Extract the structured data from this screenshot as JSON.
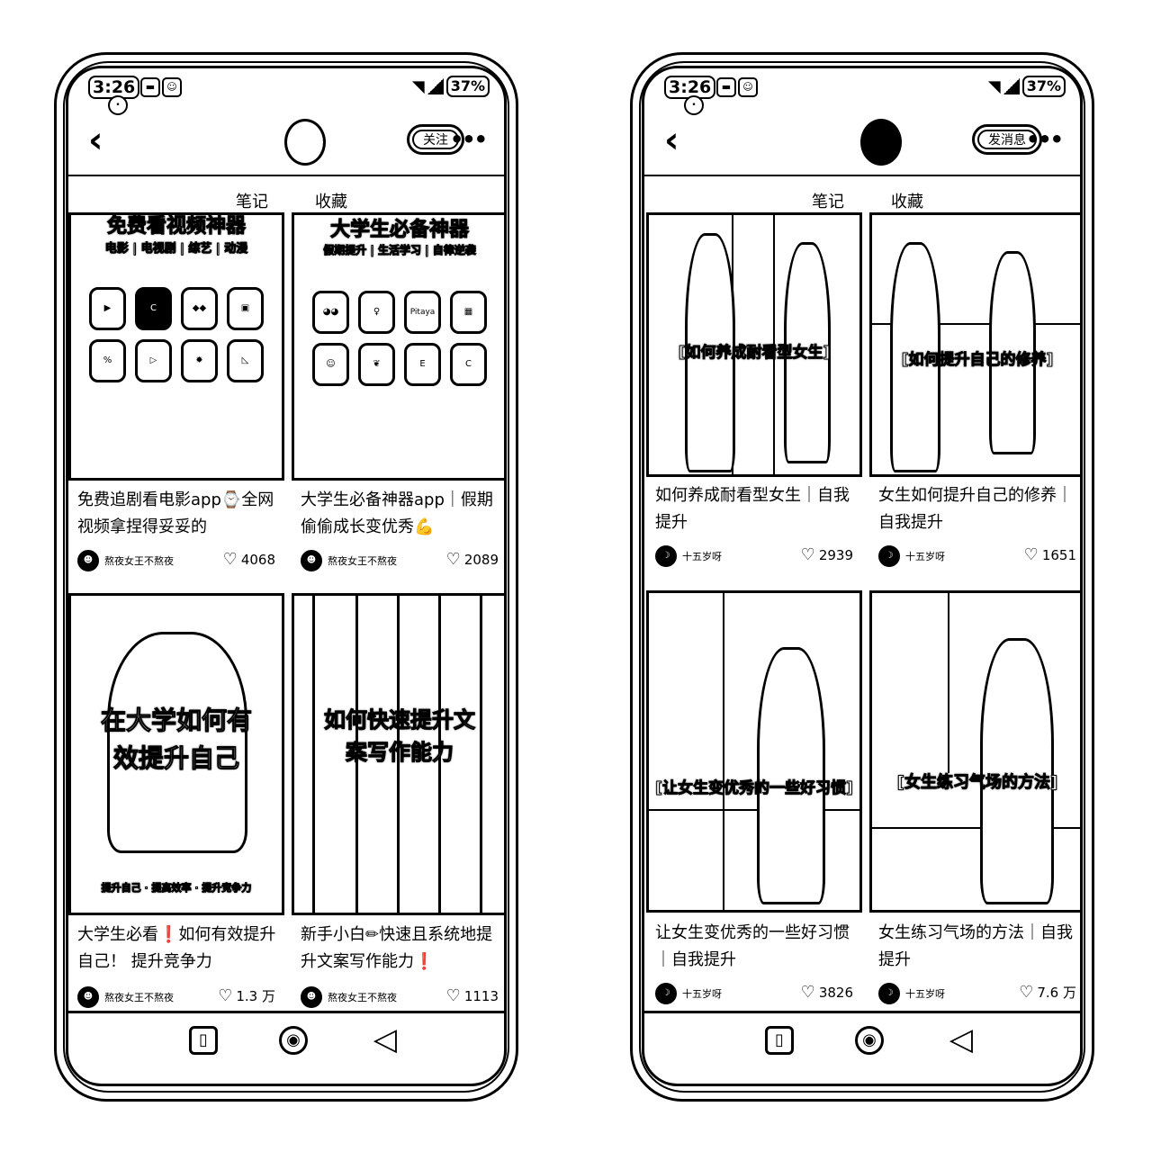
{
  "left": {
    "status": {
      "time": "3:26",
      "battery": "37%"
    },
    "header": {
      "action_label": "关注"
    },
    "tabs": [
      {
        "label": "笔记",
        "active": true
      },
      {
        "label": "收藏",
        "active": false
      }
    ],
    "cards": [
      {
        "thumb_text": "免费看视频神器",
        "thumb_sub": "电影 | 电视剧 | 综艺 | 动漫",
        "title": "免费追剧看电影app⌚全网视频拿捏得妥妥的",
        "author": "熬夜女王不熬夜",
        "likes": "4068"
      },
      {
        "thumb_text": "大学生必备神器",
        "thumb_sub": "假期提升 | 生活学习 | 自律逆袭",
        "title": "大学生必备神器app｜假期偷偷成长变优秀💪",
        "author": "熬夜女王不熬夜",
        "likes": "2089"
      },
      {
        "thumb_text": "在大学如何有效提升自己",
        "thumb_sub": "提升自己 · 提高效率 · 提升竞争力",
        "title": "大学生必看❗如何有效提升自己！ 提升竞争力",
        "author": "熬夜女王不熬夜",
        "likes": "1.3 万"
      },
      {
        "thumb_text": "如何快速提升文案写作能力",
        "thumb_sub": "",
        "title": "新手小白✏快速且系统地提升文案写作能力❗",
        "author": "熬夜女王不熬夜",
        "likes": "1113"
      }
    ]
  },
  "right": {
    "status": {
      "time": "3:26",
      "battery": "37%"
    },
    "header": {
      "action_label": "发消息"
    },
    "tabs": [
      {
        "label": "笔记",
        "active": true
      },
      {
        "label": "收藏",
        "active": false
      }
    ],
    "cards": [
      {
        "thumb_text": "[如何养成耐看型女生]",
        "title": "如何养成耐看型女生｜自我提升",
        "author": "十五岁呀",
        "likes": "2939"
      },
      {
        "thumb_text": "[如何提升自己的修养]",
        "title": "女生如何提升自己的修养｜自我提升",
        "author": "十五岁呀",
        "likes": "1651"
      },
      {
        "thumb_text": "[让女生变优秀的一些好习惯]",
        "title": "让女生变优秀的一些好习惯｜自我提升",
        "author": "十五岁呀",
        "likes": "3826"
      },
      {
        "thumb_text": "[女生练习气场的方法]",
        "title": "女生练习气场的方法｜自我提升",
        "author": "十五岁呀",
        "likes": "7.6 万"
      }
    ]
  },
  "icons": {
    "back": "chevron-left-icon",
    "more": "more-dots-icon",
    "like": "heart-icon",
    "nav": [
      "square-recents-icon",
      "circle-home-icon",
      "triangle-back-icon"
    ]
  }
}
